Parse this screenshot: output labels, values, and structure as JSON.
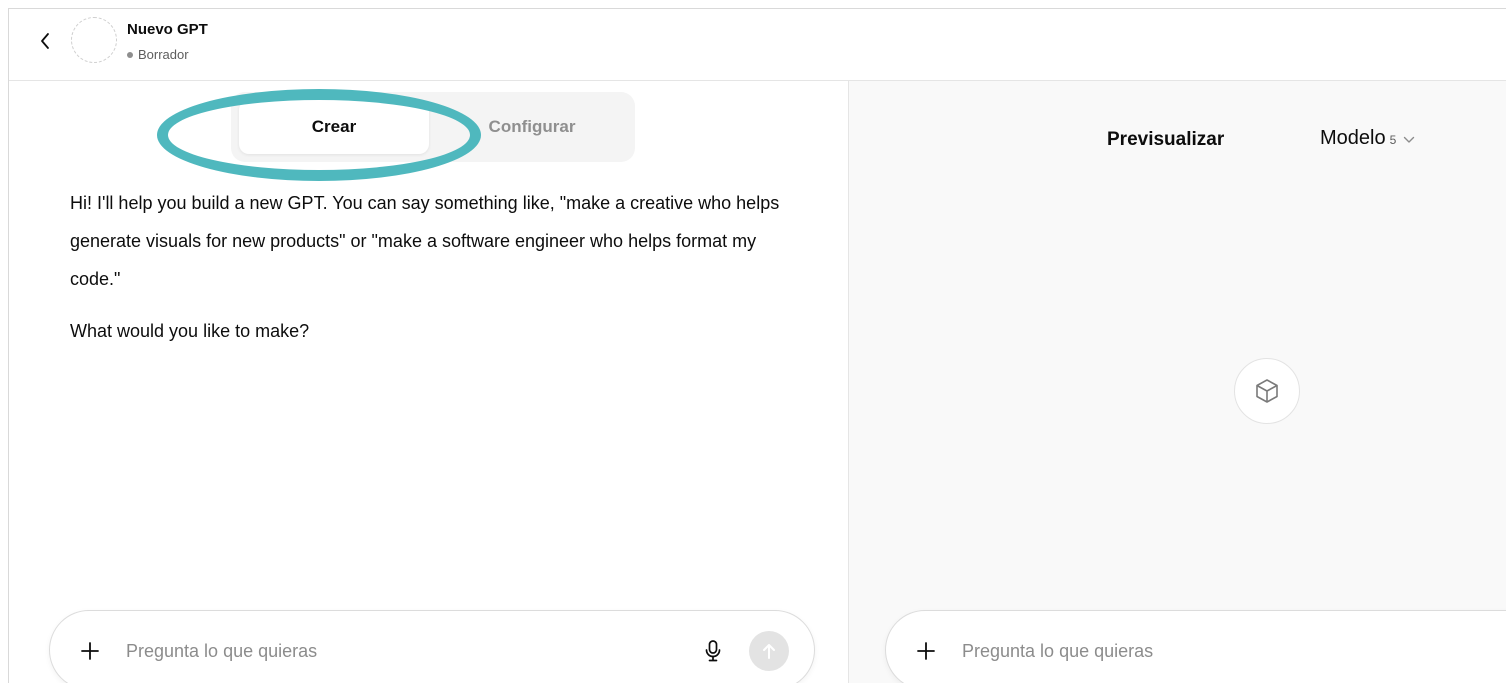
{
  "header": {
    "title": "Nuevo GPT",
    "status": "Borrador"
  },
  "tabs": {
    "create_label": "Crear",
    "configure_label": "Configurar",
    "active": "Crear"
  },
  "builder": {
    "intro": "Hi! I'll help you build a new GPT. You can say something like, \"make a creative who helps generate visuals for new products\" or \"make a software engineer who helps format my code.\"",
    "question": "What would you like to make?",
    "composer_placeholder": "Pregunta lo que quieras"
  },
  "preview": {
    "title": "Previsualizar",
    "model_label": "Modelo",
    "model_version": "5",
    "composer_placeholder": "Pregunta lo que quieras"
  },
  "icons": {
    "back": "chevron-left-icon",
    "plus": "plus-icon",
    "mic": "microphone-icon",
    "send": "arrow-up-icon",
    "model_dropdown": "chevron-down-icon",
    "placeholder": "cube-icon"
  },
  "colors": {
    "highlight_ring": "#4fb8be",
    "preview_bg": "#f9f9f9",
    "segmented_bg": "#f4f4f4"
  }
}
